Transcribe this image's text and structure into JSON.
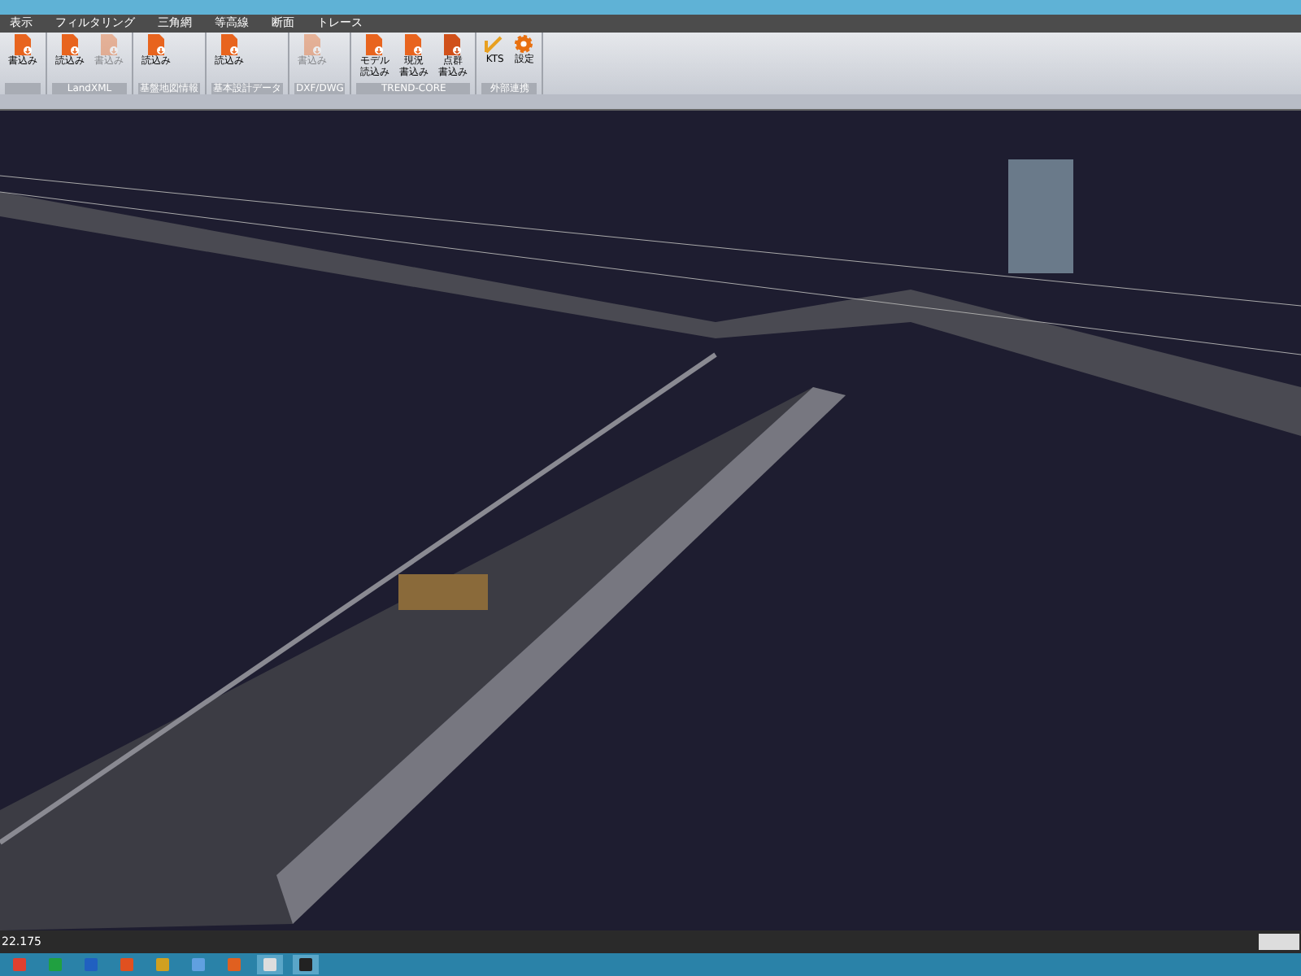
{
  "menu": [
    {
      "label": "表示"
    },
    {
      "label": "フィルタリング"
    },
    {
      "label": "三角網"
    },
    {
      "label": "等高線"
    },
    {
      "label": "断面"
    },
    {
      "label": "トレース"
    }
  ],
  "ribbon_groups": [
    {
      "buttons": [
        {
          "label": "書込み",
          "kind": "write",
          "disabled": false
        }
      ]
    },
    {
      "label": "LandXML",
      "buttons": [
        {
          "label": "読込み",
          "kind": "read",
          "disabled": false
        },
        {
          "label": "書込み",
          "kind": "write",
          "disabled": true
        }
      ]
    },
    {
      "label": "基盤地図情報",
      "buttons": [
        {
          "label": "読込み",
          "kind": "read",
          "disabled": false
        }
      ]
    },
    {
      "label": "基本設計データ",
      "buttons": [
        {
          "label": "読込み",
          "kind": "read",
          "disabled": false
        }
      ]
    },
    {
      "label": "DXF/DWG",
      "buttons": [
        {
          "label": "書込み",
          "kind": "write",
          "disabled": true
        }
      ]
    },
    {
      "label": "TREND-CORE",
      "buttons": [
        {
          "lines": [
            "モデル",
            "読込み"
          ],
          "kind": "model",
          "disabled": false
        },
        {
          "lines": [
            "現況",
            "書込み"
          ],
          "kind": "write",
          "disabled": false
        },
        {
          "lines": [
            "点群",
            "書込み"
          ],
          "kind": "cloud",
          "disabled": false
        }
      ]
    },
    {
      "label": "外部連携",
      "buttons": [
        {
          "label": "KTS",
          "kind": "kts",
          "disabled": false
        },
        {
          "label": "設定",
          "kind": "gear",
          "disabled": false
        }
      ]
    }
  ],
  "status_bar": {
    "coordinate": "22.175"
  },
  "taskbar": [
    {
      "kind": "browser",
      "selected": false
    },
    {
      "kind": "sheet",
      "selected": false
    },
    {
      "kind": "doc",
      "selected": false
    },
    {
      "kind": "slides",
      "selected": false
    },
    {
      "kind": "tool",
      "selected": false
    },
    {
      "kind": "file",
      "selected": false
    },
    {
      "kind": "globe",
      "selected": false
    },
    {
      "kind": "app",
      "selected": true
    },
    {
      "kind": "terminal",
      "selected": true
    }
  ]
}
